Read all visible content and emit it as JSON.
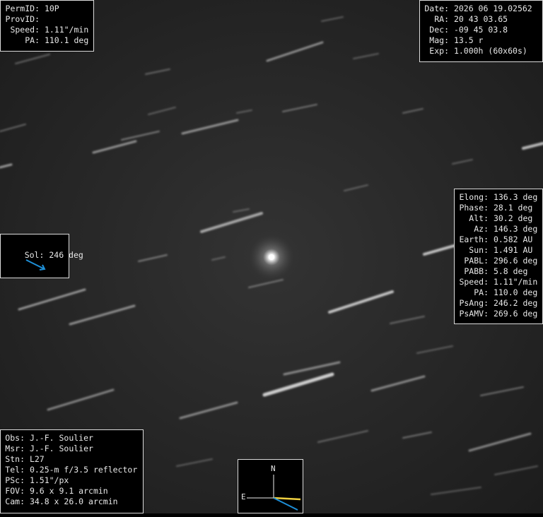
{
  "top_left": {
    "rows": [
      {
        "label": "PermID:",
        "value": "10P"
      },
      {
        "label": "ProvID:",
        "value": ""
      },
      {
        "label": "Speed:",
        "value": "1.11\"/min"
      },
      {
        "label": "PA:",
        "value": "110.1 deg"
      }
    ]
  },
  "top_right": {
    "rows": [
      {
        "label": "Date:",
        "value": "2026 06 19.02562"
      },
      {
        "label": "RA:",
        "value": "20 43 03.65"
      },
      {
        "label": "Dec:",
        "value": "-09 45 03.8"
      },
      {
        "label": "Mag:",
        "value": "13.5 r"
      },
      {
        "label": "Exp:",
        "value": "1.000h (60x60s)"
      }
    ]
  },
  "right_panel": {
    "rows": [
      {
        "label": "Elong:",
        "value": "136.3 deg"
      },
      {
        "label": "Phase:",
        "value": "28.1 deg"
      },
      {
        "label": "Alt:",
        "value": "30.2 deg"
      },
      {
        "label": "Az:",
        "value": "146.3 deg"
      },
      {
        "label": "Earth:",
        "value": "0.582 AU"
      },
      {
        "label": "Sun:",
        "value": "1.491 AU"
      },
      {
        "label": "PABL:",
        "value": "296.6 deg"
      },
      {
        "label": "PABB:",
        "value": "5.8 deg"
      },
      {
        "label": "Speed:",
        "value": "1.11\"/min"
      },
      {
        "label": "PA:",
        "value": "110.0 deg"
      },
      {
        "label": "PsAng:",
        "value": "246.2 deg"
      },
      {
        "label": "PsAMV:",
        "value": "269.6 deg"
      }
    ]
  },
  "sol_panel": {
    "label": "Sol:",
    "value": "246 deg",
    "arrow_color": "#1e90d8"
  },
  "bottom_left": {
    "rows": [
      {
        "label": "Obs:",
        "value": "J.-F. Soulier"
      },
      {
        "label": "Msr:",
        "value": "J.-F. Soulier"
      },
      {
        "label": "Stn:",
        "value": "L27"
      },
      {
        "label": "Tel:",
        "value": "0.25-m f/3.5 reflector"
      },
      {
        "label": "PSc:",
        "value": "1.51\"/px"
      },
      {
        "label": "FOV:",
        "value": "9.6 x 9.1 arcmin"
      },
      {
        "label": "Cam:",
        "value": "34.8 x 26.0 arcmin"
      }
    ]
  },
  "compass": {
    "north": "N",
    "east": "E",
    "motion_color": "#f0d040",
    "sun_color": "#1e90d8"
  },
  "colors": {
    "background": "#2a2a2a",
    "border": "#dcdcdc",
    "text": "#e8e8e8"
  }
}
